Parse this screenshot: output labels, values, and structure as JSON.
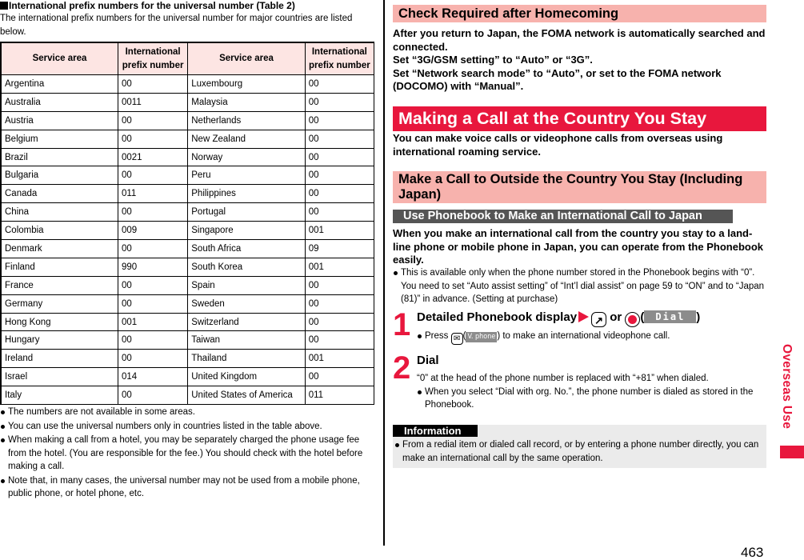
{
  "left": {
    "section_title": "International prefix numbers for the universal number (Table 2)",
    "intro": "The international prefix numbers for the universal number for major countries are listed below.",
    "table": {
      "headers": [
        "Service area",
        "International prefix number",
        "Service area",
        "International prefix number"
      ],
      "rows": [
        [
          "Argentina",
          "00",
          "Luxembourg",
          "00"
        ],
        [
          "Australia",
          "0011",
          "Malaysia",
          "00"
        ],
        [
          "Austria",
          "00",
          "Netherlands",
          "00"
        ],
        [
          "Belgium",
          "00",
          "New Zealand",
          "00"
        ],
        [
          "Brazil",
          "0021",
          "Norway",
          "00"
        ],
        [
          "Bulgaria",
          "00",
          "Peru",
          "00"
        ],
        [
          "Canada",
          "011",
          "Philippines",
          "00"
        ],
        [
          "China",
          "00",
          "Portugal",
          "00"
        ],
        [
          "Colombia",
          "009",
          "Singapore",
          "001"
        ],
        [
          "Denmark",
          "00",
          "South Africa",
          "09"
        ],
        [
          "Finland",
          "990",
          "South Korea",
          "001"
        ],
        [
          "France",
          "00",
          "Spain",
          "00"
        ],
        [
          "Germany",
          "00",
          "Sweden",
          "00"
        ],
        [
          "Hong Kong",
          "001",
          "Switzerland",
          "00"
        ],
        [
          "Hungary",
          "00",
          "Taiwan",
          "00"
        ],
        [
          "Ireland",
          "00",
          "Thailand",
          "001"
        ],
        [
          "Israel",
          "014",
          "United Kingdom",
          "00"
        ],
        [
          "Italy",
          "00",
          "United States of America",
          "011"
        ]
      ]
    },
    "notes": [
      "The numbers are not available in some areas.",
      "You can use the universal numbers only in countries listed in the table above.",
      "When making a call from a hotel, you may be separately charged the phone usage fee from the hotel. (You are responsible for the fee.) You should check with the hotel before making a call.",
      "Note that, in many cases, the universal number may not be used from a mobile phone, public phone, or hotel phone, etc."
    ]
  },
  "right": {
    "homecoming": {
      "title": "Check Required after Homecoming",
      "body": [
        "After you return to Japan, the FOMA network is automatically searched and connected.",
        "Set “3G/GSM setting” to “Auto” or “3G”.",
        "Set “Network search mode” to “Auto”, or set to the FOMA network (DOCOMO) with “Manual”."
      ]
    },
    "making_call": {
      "title": "Making a Call at the Country You Stay",
      "body": "You can make voice calls or videophone calls from overseas using international roaming service."
    },
    "outside_call": {
      "title": "Make a Call to Outside the Country You Stay (Including Japan)"
    },
    "phonebook": {
      "title": "Use Phonebook to Make an International Call to Japan",
      "body": "When you make an international call from the country you stay to a land-line phone or mobile phone in Japan, you can operate from the Phonebook easily.",
      "note": "This is available only when the phone number stored in the Phonebook begins with “0”. You need to set “Auto assist setting” of “Int’l dial assist” on page 59 to “ON” and to “Japan (81)” in advance. (Setting at purchase)"
    },
    "steps": [
      {
        "number": "1",
        "title": "Detailed Phonebook display",
        "or_text": "or",
        "softkey": "Dial",
        "note_prefix": "Press",
        "note_softkey": "V. phone",
        "note_suffix": "to make an international videophone call."
      },
      {
        "number": "2",
        "title": "Dial",
        "text": "“0” at the head of the phone number is replaced with “+81” when dialed.",
        "note": "When you select “Dial with org. No.”, the phone number is dialed as stored in the Phonebook."
      }
    ],
    "information": {
      "label": "Information",
      "note": "From a redial item or dialed call record, or by entering a phone number directly, you can make an international call by the same operation."
    }
  },
  "side_tab": "Overseas Use",
  "page_number": "463",
  "colors": {
    "accent_red": "#e8173d",
    "header_pink": "#f7b2ad",
    "table_header_pink": "#fde5e3",
    "dark_bar": "#555555",
    "info_gray": "#ebebeb"
  }
}
